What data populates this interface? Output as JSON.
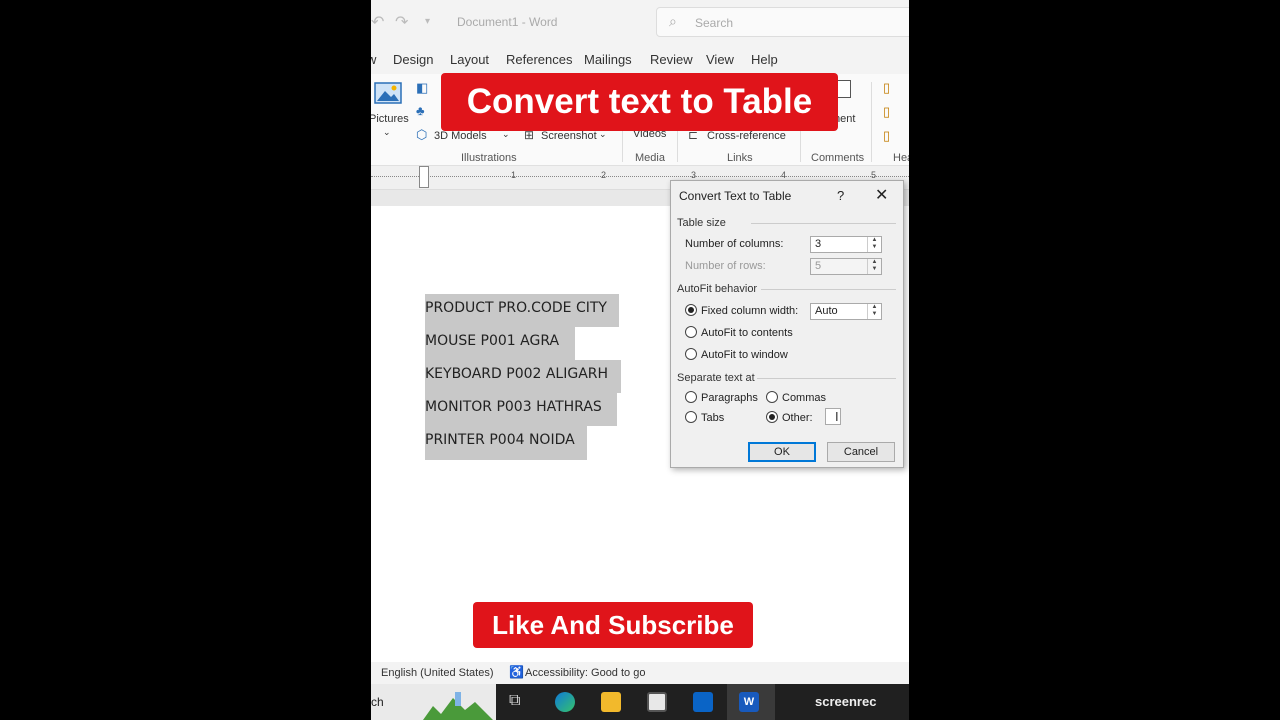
{
  "app": {
    "doc_title": "Document1 - Word",
    "search_placeholder": "Search"
  },
  "tabs": [
    "w",
    "Design",
    "Layout",
    "References",
    "Mailings",
    "Review",
    "View",
    "Help"
  ],
  "ribbon": {
    "pictures": "Pictures",
    "models": "3D Models",
    "screenshot": "Screenshot",
    "videos": "Videos",
    "cross_reference": "Cross-reference",
    "comment": "ment",
    "groups": {
      "illustrations": "Illustrations",
      "media": "Media",
      "links": "Links",
      "comments": "Comments",
      "header": "Hea"
    }
  },
  "ruler_numbers": [
    "1",
    "2",
    "3",
    "4",
    "5"
  ],
  "document_lines": [
    "PRODUCT PRO.CODE CITY",
    "MOUSE P001 AGRA",
    "KEYBOARD P002 ALIGARH",
    "MONITOR P003 HATHRAS",
    "PRINTER P004 NOIDA"
  ],
  "banners": {
    "top": "Convert text to Table",
    "bottom": "Like And Subscribe"
  },
  "dialog": {
    "title": "Convert Text to Table",
    "help": "?",
    "close": "✕",
    "table_size": "Table size",
    "columns_label": "Number of columns:",
    "columns_value": "3",
    "rows_label": "Number of rows:",
    "rows_value": "5",
    "autofit": "AutoFit behavior",
    "fixed_width": "Fixed column width:",
    "fixed_value": "Auto",
    "autofit_contents": "AutoFit to contents",
    "autofit_window": "AutoFit to window",
    "separate": "Separate text at",
    "paragraphs": "Paragraphs",
    "commas": "Commas",
    "tabs": "Tabs",
    "other": "Other:",
    "ok": "OK",
    "cancel": "Cancel"
  },
  "status": {
    "language": "English (United States)",
    "accessibility": "Accessibility: Good to go"
  },
  "taskbar": {
    "left_text": "ch",
    "recorder": "screenrec"
  },
  "colors": {
    "accent_red": "#e0141a",
    "focus_blue": "#0078d7"
  }
}
